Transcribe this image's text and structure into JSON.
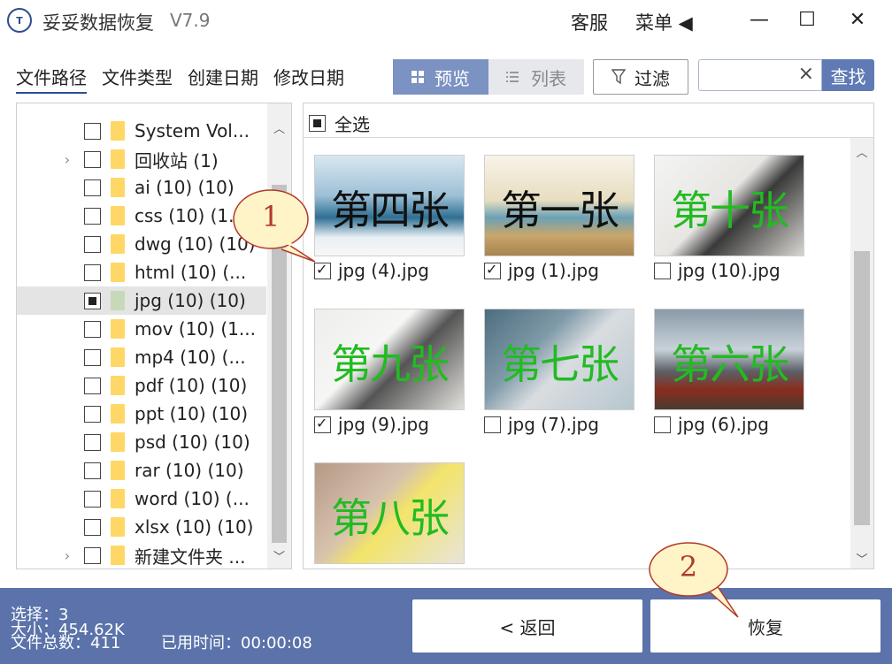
{
  "titlebar": {
    "logo_text": "T",
    "title": "妥妥数据恢复",
    "version": "V7.9",
    "service_label": "客服",
    "menu_label": "菜单 ◀"
  },
  "window_controls": {
    "minimize": "—",
    "maximize": "☐",
    "close": "✕"
  },
  "nav_tabs": [
    "文件路径",
    "文件类型",
    "创建日期",
    "修改日期"
  ],
  "view_toggle": {
    "preview_label": "预览",
    "list_label": "列表"
  },
  "filter": {
    "label": "过滤"
  },
  "search": {
    "value": "",
    "placeholder": "",
    "clear": "×",
    "button_label": "查找"
  },
  "tree": {
    "items": [
      {
        "label": "System Vol...",
        "checked": "none",
        "expander": ""
      },
      {
        "label": "回收站  (1)",
        "checked": "none",
        "expander": "›"
      },
      {
        "label": "ai (10)  (10)",
        "checked": "none",
        "expander": ""
      },
      {
        "label": "css (10)  (1...",
        "checked": "none",
        "expander": ""
      },
      {
        "label": "dwg (10)  (10)",
        "checked": "none",
        "expander": ""
      },
      {
        "label": "html (10)  (...",
        "checked": "none",
        "expander": ""
      },
      {
        "label": "jpg (10)  (10)",
        "checked": "partial",
        "expander": "",
        "selected": true
      },
      {
        "label": "mov (10)  (1...",
        "checked": "none",
        "expander": ""
      },
      {
        "label": "mp4 (10)  (...",
        "checked": "none",
        "expander": ""
      },
      {
        "label": "pdf (10)  (10)",
        "checked": "none",
        "expander": ""
      },
      {
        "label": "ppt (10)  (10)",
        "checked": "none",
        "expander": ""
      },
      {
        "label": "psd (10)  (10)",
        "checked": "none",
        "expander": ""
      },
      {
        "label": "rar (10)  (10)",
        "checked": "none",
        "expander": ""
      },
      {
        "label": "word (10)  (...",
        "checked": "none",
        "expander": ""
      },
      {
        "label": "xlsx (10)  (10)",
        "checked": "none",
        "expander": ""
      },
      {
        "label": "新建文件夹  ...",
        "checked": "none",
        "expander": "›"
      }
    ]
  },
  "preview": {
    "select_all_label": "全选",
    "files": [
      {
        "name": "jpg (4).jpg",
        "checked": true,
        "thumb_text": "第四张",
        "text_color": "#111111"
      },
      {
        "name": "jpg (1).jpg",
        "checked": true,
        "thumb_text": "第一张",
        "text_color": "#111111"
      },
      {
        "name": "jpg (10).jpg",
        "checked": false,
        "thumb_text": "第十张",
        "text_color": "#22bb22"
      },
      {
        "name": "jpg (9).jpg",
        "checked": true,
        "thumb_text": "第九张",
        "text_color": "#22bb22"
      },
      {
        "name": "jpg (7).jpg",
        "checked": false,
        "thumb_text": "第七张",
        "text_color": "#22bb22"
      },
      {
        "name": "jpg (6).jpg",
        "checked": false,
        "thumb_text": "第六张",
        "text_color": "#22bb22"
      },
      {
        "name": "",
        "checked": false,
        "thumb_text": "第八张",
        "text_color": "#22bb22"
      }
    ]
  },
  "status": {
    "selected": "选择：3",
    "size": "大小：454.62K",
    "total": "文件总数：411",
    "elapsed": "已用时间：00:00:08"
  },
  "buttons": {
    "back_label": "< 返回",
    "recover_label": "恢复"
  },
  "callouts": [
    {
      "number": "1"
    },
    {
      "number": "2"
    }
  ],
  "colors": {
    "accent": "#5b73aa",
    "folder": "#ffd766",
    "callout_fill": "#fff3c8",
    "callout_stroke": "#b23a2a"
  }
}
